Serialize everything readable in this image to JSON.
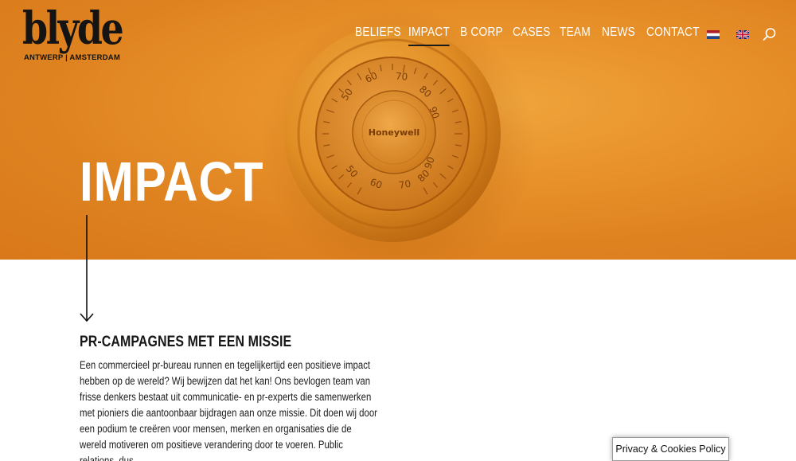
{
  "brand": {
    "logo_word": "blyde",
    "logo_sub": "ANTWERP | AMSTERDAM"
  },
  "nav": {
    "items": [
      {
        "label": "BELIEFS",
        "active": false
      },
      {
        "label": "IMPACT",
        "active": true
      },
      {
        "label": "B CORP",
        "active": false
      },
      {
        "label": "CASES",
        "active": false
      },
      {
        "label": "TEAM",
        "active": false
      },
      {
        "label": "NEWS",
        "active": false
      },
      {
        "label": "CONTACT",
        "active": false
      }
    ],
    "flags": [
      "dutch-flag-icon",
      "english-flag-icon"
    ],
    "search_icon": "search-icon"
  },
  "hero": {
    "title": "IMPACT",
    "image": {
      "brand_label": "Honeywell",
      "dial_numbers": [
        "50",
        "60",
        "70",
        "80",
        "90",
        "90",
        "80",
        "70",
        "60",
        "50"
      ],
      "colors": {
        "background": "#e8912a",
        "dial": "#d9881e"
      }
    }
  },
  "content": {
    "heading": "PR-CAMPAGNES MET EEN MISSIE",
    "paragraph": "Een commercieel pr-bureau runnen en tegelijkertijd een positieve impact hebben op de wereld? Wij bewijzen dat het kan! Ons bevlogen team van frisse denkers bestaat uit communicatie- en pr-experts die samenwerken met pioniers die aantoonbaar bijdragen aan onze missie. Dit doen wij door een podium te creëren voor mensen, merken en organisaties die de wereld motiveren om positieve verandering door te voeren. Public relations, dus."
  },
  "cookie": {
    "label": "Privacy & Cookies Policy"
  }
}
